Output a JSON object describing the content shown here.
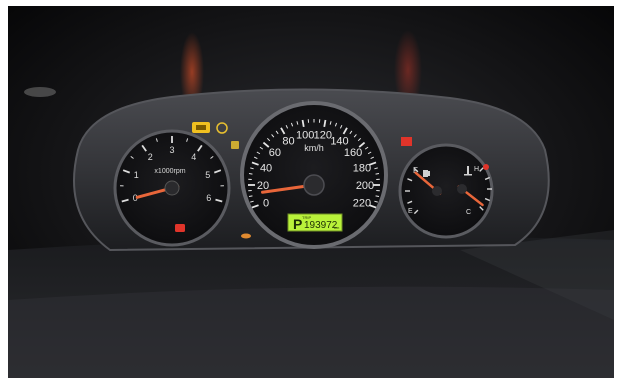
{
  "photo": {
    "tach": {
      "unit": "x1000rpm",
      "labels": [
        "0",
        "1",
        "2",
        "3",
        "4",
        "5",
        "6"
      ],
      "needle_value": 0
    },
    "speedo": {
      "unit": "km/h",
      "labels": [
        "0",
        "20",
        "40",
        "60",
        "80",
        "100",
        "120",
        "140",
        "160",
        "180",
        "200",
        "220"
      ],
      "needle_value": 12
    },
    "odometer": {
      "gear": "P",
      "reading": "193972",
      "unit_top": "TRIP",
      "unit_bottom": "km"
    },
    "fuel_gauge": {
      "full": "F",
      "empty": "E",
      "level": 0.95
    },
    "temp_gauge": {
      "hot": "H",
      "cold": "C",
      "level": 0.08
    },
    "colors": {
      "needle": "#e8663a",
      "odometer_lcd": "#b9f23a",
      "warning_amber": "#f0c020",
      "warning_red": "#e0342a",
      "dial_face": "#151517",
      "bezel": "#2c2d31"
    },
    "icons": [
      "engine-warning-icon",
      "brake-warning-icon",
      "oil-pressure-icon",
      "battery-warning-icon",
      "seatbelt-warning-icon",
      "fuel-pump-icon",
      "coolant-temp-icon",
      "airbag-warning-icon"
    ]
  }
}
